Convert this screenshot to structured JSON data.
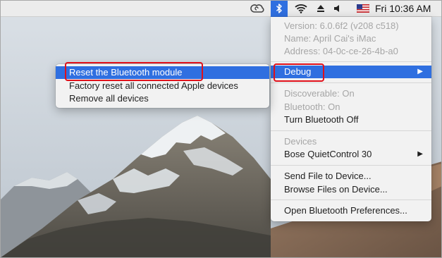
{
  "menubar": {
    "clock": "Fri 10:36 AM",
    "icons": [
      "creative-cloud-icon",
      "bluetooth-icon",
      "wifi-icon",
      "eject-icon",
      "volume-icon",
      "us-flag-icon"
    ]
  },
  "bluetooth_menu": {
    "version": "Version: 6.0.6f2 (v208 c518)",
    "name": "Name: April Cai's iMac",
    "address": "Address: 04-0c-ce-26-4b-a0",
    "debug": "Debug",
    "discoverable": "Discoverable: On",
    "bluetooth_status": "Bluetooth: On",
    "turn_off": "Turn Bluetooth Off",
    "devices_header": "Devices",
    "device_1": "Bose QuietControl 30",
    "send_file": "Send File to Device...",
    "browse_files": "Browse Files on Device...",
    "open_prefs": "Open Bluetooth Preferences..."
  },
  "debug_submenu": {
    "reset_module": "Reset the Bluetooth module",
    "factory_reset": "Factory reset all connected Apple devices",
    "remove_all": "Remove all devices"
  },
  "colors": {
    "highlight": "#2f6fe0",
    "annotation": "#e0101a",
    "menubar": "#ececec",
    "menu_bg": "#f2f2f2"
  }
}
